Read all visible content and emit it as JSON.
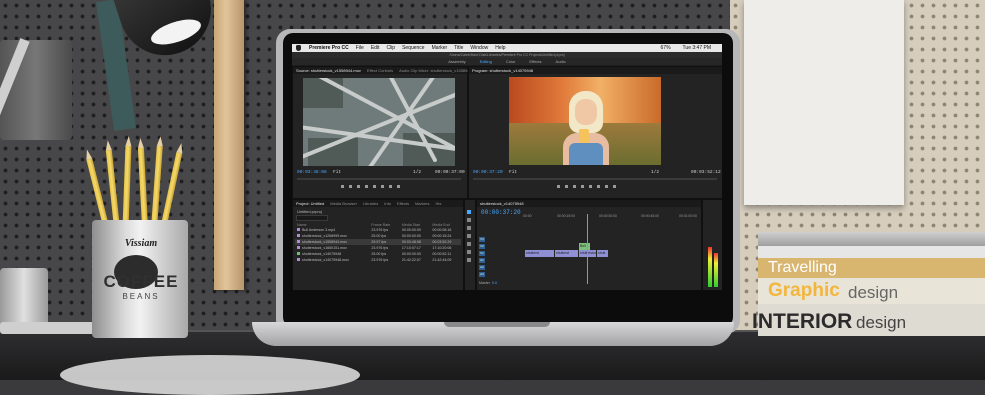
{
  "app": {
    "name": "Premiere Pro CC",
    "menus": [
      "File",
      "Edit",
      "Clip",
      "Sequence",
      "Marker",
      "Title",
      "Window",
      "Help"
    ],
    "status": [
      "67%",
      "Tue 3:47 PM"
    ],
    "project_path": "/Users/Caleb/Hard Disk/Libraries/Premiere Pro CC Projects/Untitled.prproj",
    "workspaces": [
      "Assembly",
      "Editing",
      "Color",
      "Effects",
      "Audio"
    ],
    "active_workspace": "Editing"
  },
  "source": {
    "tabs": [
      "Source: shutterstock_v1558944.mov",
      "Effect Controls",
      "Audio Clip Mixer: shutterstock_v1558944"
    ],
    "tc_left": "00:03:48:08",
    "fit": "Fit",
    "ratio": "1/2",
    "tc_right": "00:00:37:00"
  },
  "program": {
    "tab": "Program: shutterstock_v14075948",
    "tc_left": "00:00:37:20",
    "fit": "Fit",
    "ratio": "1/2",
    "tc_right": "00:03:52:12"
  },
  "project": {
    "tabs": [
      "Project: Untitled",
      "Media Browser",
      "Libraries",
      "Info",
      "Effects",
      "Markers",
      "His"
    ],
    "file": "Untitled.prproj",
    "columns": [
      "Name",
      "Frame Rate",
      "Media Start",
      "Media End"
    ],
    "rows": [
      {
        "name": "Bull Anderson 3.mp4",
        "fps": "23.976 fps",
        "start": "00:00:00:00",
        "end": "00:00:08:16",
        "color": "#b08ad6"
      },
      {
        "name": "shutterstock_v1268999.mov",
        "fps": "25.00 fps",
        "start": "00:00:00:00",
        "end": "00:00:15:24",
        "color": "#b08ad6"
      },
      {
        "name": "shutterstock_v1558944.mov",
        "fps": "29.97 fps",
        "start": "00:03:48:08",
        "end": "00:03:52:29",
        "color": "#b08ad6"
      },
      {
        "name": "shutterstock_v1660151.mov",
        "fps": "23.976 fps",
        "start": "17:10:07:17",
        "end": "17:10:20:06",
        "color": "#b08ad6"
      },
      {
        "name": "shutterstock_v14075948",
        "fps": "25.00 fps",
        "start": "00:00:00:00",
        "end": "00:00:52:11",
        "color": "#6cbf6c"
      },
      {
        "name": "shutterstock_v14075948.mov",
        "fps": "23.976 fps",
        "start": "21:42:22:07",
        "end": "21:42:44:09",
        "color": "#b08ad6"
      }
    ]
  },
  "timeline": {
    "tab": "shutterstock_v14075948",
    "tc": "00:00:37:20",
    "ruler": [
      "00:00",
      "00:00:15:00",
      "00:00:30:00",
      "00:00:45:00",
      "00:01:00:00"
    ],
    "tracks": [
      "V3",
      "V2",
      "V1",
      "A1",
      "A2",
      "A3",
      "Master"
    ],
    "master_value": "0.0",
    "clips": [
      "shutterst",
      "shutterst",
      "shutterstoc",
      "shutt",
      "Bull"
    ]
  },
  "scene": {
    "books": [
      "Travelling",
      "Graphic",
      "design",
      "INTERIOR",
      "design"
    ],
    "cup": [
      "COFFEE",
      "BEANS",
      "Vissiam"
    ]
  }
}
